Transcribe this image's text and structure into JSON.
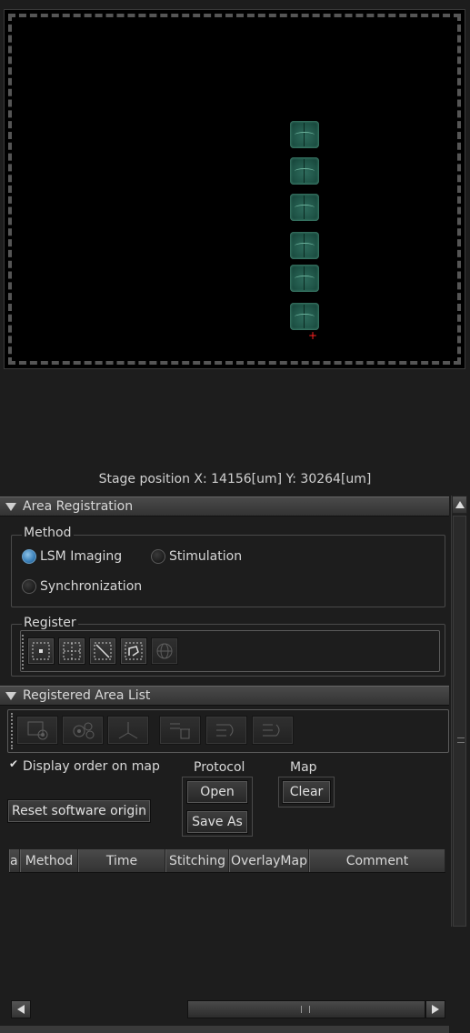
{
  "stage": {
    "position_text": "Stage position  X: 14156[um] Y: 30264[um]",
    "marker_glyph": "+",
    "sample_count": 6
  },
  "area_registration": {
    "title": "Area Registration",
    "method": {
      "label": "Method",
      "options": [
        {
          "label": "LSM Imaging",
          "selected": true
        },
        {
          "label": "Stimulation",
          "selected": false
        },
        {
          "label": "Synchronization",
          "selected": false
        }
      ]
    },
    "register": {
      "label": "Register",
      "tools": [
        "point-register-icon",
        "tile-register-icon",
        "diagonal-area-icon",
        "polygon-area-icon",
        "globe-grid-icon"
      ]
    }
  },
  "registered_area_list": {
    "title": "Registered Area List",
    "toolbar": [
      "settings-area-icon",
      "camera-settings-icon",
      "stage-axis-icon",
      "delete-list-icon",
      "move-list-up-icon",
      "move-list-down-icon"
    ],
    "display_order_label": "Display order on map",
    "display_order_checked": true,
    "protocol": {
      "label": "Protocol",
      "open": "Open",
      "save_as": "Save As"
    },
    "map": {
      "label": "Map",
      "clear": "Clear"
    },
    "reset_origin": "Reset software origin",
    "columns": [
      "a",
      "Method",
      "Time",
      "Stitching",
      "OverlayMap",
      "Comment"
    ]
  },
  "colors": {
    "background": "#1d1d1d",
    "accent_radio": "#3a7fb8",
    "sample_tissue": "#2e6b5c",
    "marker": "#ff2222"
  }
}
